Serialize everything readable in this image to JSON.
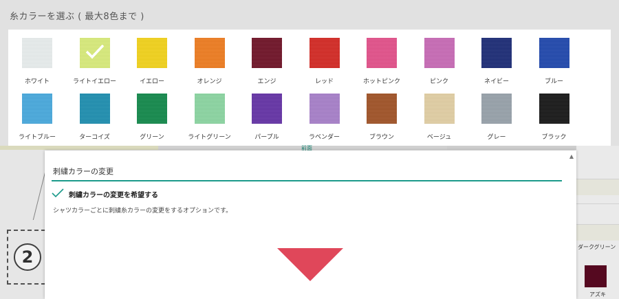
{
  "palette": {
    "title": "糸カラーを選ぶ ( 最大8色まで )",
    "selected_index": 1,
    "colors": [
      {
        "label": "ホワイト",
        "color": "#e9eeee"
      },
      {
        "label": "ライトイエロー",
        "color": "#d9ec7a"
      },
      {
        "label": "イエロー",
        "color": "#f3d31a"
      },
      {
        "label": "オレンジ",
        "color": "#ef7c1f"
      },
      {
        "label": "エンジ",
        "color": "#6f1226"
      },
      {
        "label": "レッド",
        "color": "#d42823"
      },
      {
        "label": "ホットピンク",
        "color": "#e3508a"
      },
      {
        "label": "ピンク",
        "color": "#c86ab6"
      },
      {
        "label": "ネイビー",
        "color": "#1b2b76"
      },
      {
        "label": "ブルー",
        "color": "#1f47ad"
      },
      {
        "label": "ライトブルー",
        "color": "#47a9de"
      },
      {
        "label": "ターコイズ",
        "color": "#1d8eb0"
      },
      {
        "label": "グリーン",
        "color": "#12894b"
      },
      {
        "label": "ライトグリーン",
        "color": "#8bd6a2"
      },
      {
        "label": "パープル",
        "color": "#6432a6"
      },
      {
        "label": "ラベンダー",
        "color": "#a77fca"
      },
      {
        "label": "ブラウン",
        "color": "#a05226"
      },
      {
        "label": "ベージュ",
        "color": "#e2cfa4"
      },
      {
        "label": "グレー",
        "color": "#97a2aa"
      },
      {
        "label": "ブラック",
        "color": "#161616"
      }
    ]
  },
  "background": {
    "tab_label": "前面",
    "right_label": "ダークグリーン",
    "right_swatch_label": "アズキ",
    "number_badge": "2"
  },
  "modal": {
    "title": "刺繍カラーの変更",
    "option_label": "刺繍カラーの変更を希望する",
    "option_description": "シャツカラーごとに刺繍糸カラーの変更をするオプションです。",
    "accent_color": "#1a9a8a",
    "arrow_color": "#e0475a",
    "scroll_icon": "scroll-up-icon"
  }
}
